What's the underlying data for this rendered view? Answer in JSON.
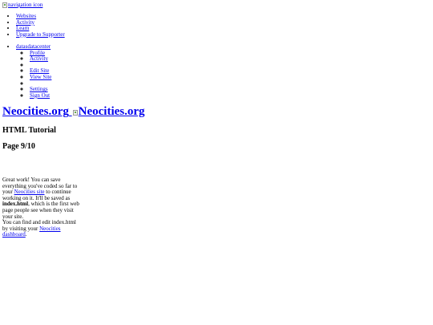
{
  "nav_image": {
    "alt": "navigation icon"
  },
  "primary_menu": {
    "websites": "Websites",
    "activity": "Activity",
    "learn": "Learn",
    "upgrade": "Upgrade to Supporter"
  },
  "user_menu": {
    "username": "datasdatacenter",
    "profile": "Profile",
    "activity": "Activity",
    "edit_site": "Edit Site",
    "view_site": "View Site",
    "settings": "Settings",
    "sign_out": "Sign Out"
  },
  "logo": {
    "text": "Neocities.org",
    "image_alt": "Neocities.org"
  },
  "tutorial": {
    "title": "HTML Tutorial",
    "page": "Page 9/10",
    "intro": "Great work! You can save everything you've coded so far to your",
    "site_link": "Neocities site",
    "continue_text": "to continue working on it. It'll be saved as",
    "filename": "index.html",
    "after_filename": ", which is the first web page people see when they visit your site.",
    "find_text": "You can find and edit index.html by visiting your",
    "dashboard_link": "Neocities dashboard",
    "period": "."
  }
}
